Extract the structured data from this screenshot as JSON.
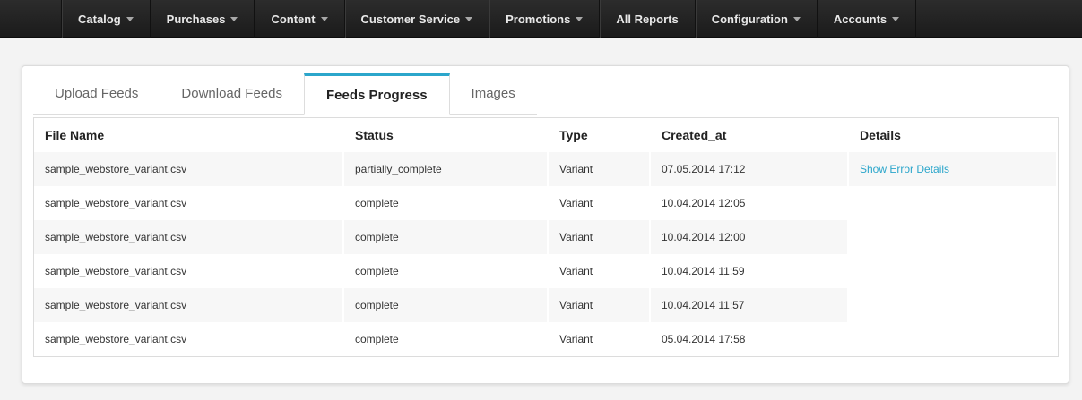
{
  "nav": {
    "items": [
      {
        "label": "Catalog",
        "dropdown": true
      },
      {
        "label": "Purchases",
        "dropdown": true
      },
      {
        "label": "Content",
        "dropdown": true
      },
      {
        "label": "Customer Service",
        "dropdown": true
      },
      {
        "label": "Promotions",
        "dropdown": true
      },
      {
        "label": "All Reports",
        "dropdown": false
      },
      {
        "label": "Configuration",
        "dropdown": true
      },
      {
        "label": "Accounts",
        "dropdown": true
      }
    ]
  },
  "tabs": [
    {
      "label": "Upload Feeds",
      "active": false
    },
    {
      "label": "Download Feeds",
      "active": false
    },
    {
      "label": "Feeds Progress",
      "active": true
    },
    {
      "label": "Images",
      "active": false
    }
  ],
  "table": {
    "columns": [
      "File Name",
      "Status",
      "Type",
      "Created_at",
      "Details"
    ],
    "rows": [
      {
        "file": "sample_webstore_variant.csv",
        "status": "partially_complete",
        "type": "Variant",
        "created": "07.05.2014 17:12",
        "details": "Show Error Details"
      },
      {
        "file": "sample_webstore_variant.csv",
        "status": "complete",
        "type": "Variant",
        "created": "10.04.2014 12:05",
        "details": ""
      },
      {
        "file": "sample_webstore_variant.csv",
        "status": "complete",
        "type": "Variant",
        "created": "10.04.2014 12:00",
        "details": ""
      },
      {
        "file": "sample_webstore_variant.csv",
        "status": "complete",
        "type": "Variant",
        "created": "10.04.2014 11:59",
        "details": ""
      },
      {
        "file": "sample_webstore_variant.csv",
        "status": "complete",
        "type": "Variant",
        "created": "10.04.2014 11:57",
        "details": ""
      },
      {
        "file": "sample_webstore_variant.csv",
        "status": "complete",
        "type": "Variant",
        "created": "05.04.2014 17:58",
        "details": ""
      }
    ]
  },
  "colors": {
    "accent": "#2ba6cb",
    "nav_bg": "#1f1f1f",
    "page_bg": "#f3f3f3"
  },
  "icons": {
    "dropdown": "chevron-down-icon"
  }
}
